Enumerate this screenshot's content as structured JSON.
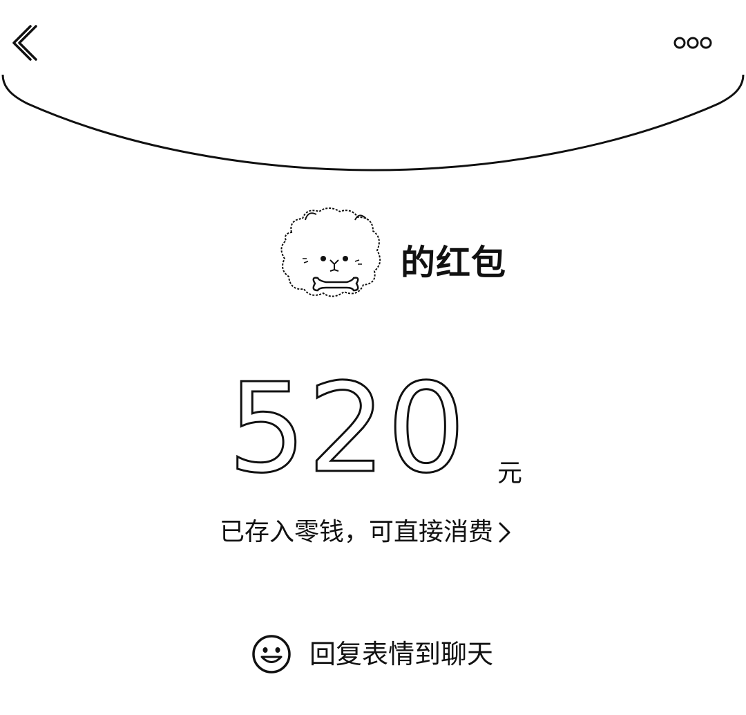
{
  "topbar": {
    "back_icon": "chevron-left-icon",
    "more_icon": "more-dots-icon"
  },
  "sender": {
    "avatar_icon": "fluffy-dog-avatar",
    "title": "的红包"
  },
  "amount": {
    "value": "520",
    "currency": "元"
  },
  "wallet": {
    "status_text": "已存入零钱，可直接消费",
    "chevron_icon": "chevron-right-icon"
  },
  "reply": {
    "icon": "smile-icon",
    "label": "回复表情到聊天"
  },
  "colors": {
    "background": "#ffffff",
    "foreground": "#111111"
  }
}
